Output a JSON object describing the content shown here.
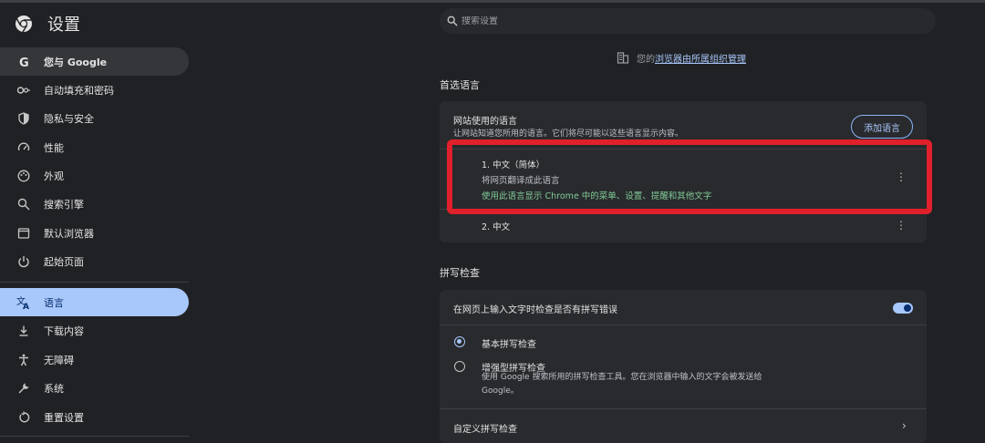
{
  "app": {
    "title": "设置"
  },
  "search": {
    "placeholder": "搜索设置"
  },
  "managed": {
    "prefix": "您的",
    "link": "浏览器由所属组织管理"
  },
  "sidebar": {
    "items": [
      {
        "label": "您与 Google",
        "icon": "google-g-icon"
      },
      {
        "label": "自动填充和密码",
        "icon": "key-icon"
      },
      {
        "label": "隐私与安全",
        "icon": "shield-icon"
      },
      {
        "label": "性能",
        "icon": "speedometer-icon"
      },
      {
        "label": "外观",
        "icon": "palette-icon"
      },
      {
        "label": "搜索引擎",
        "icon": "search-icon"
      },
      {
        "label": "默认浏览器",
        "icon": "browser-window-icon"
      },
      {
        "label": "起始页面",
        "icon": "power-icon"
      },
      {
        "label": "语言",
        "icon": "translate-icon"
      },
      {
        "label": "下载内容",
        "icon": "download-icon"
      },
      {
        "label": "无障碍",
        "icon": "accessibility-icon"
      },
      {
        "label": "系统",
        "icon": "wrench-icon"
      },
      {
        "label": "重置设置",
        "icon": "reset-icon"
      }
    ]
  },
  "preferred_languages": {
    "section_title": "首选语言",
    "card_title": "网站使用的语言",
    "card_desc": "让网站知道您所用的语言。它们将尽可能以这些语言显示内容。",
    "add_button": "添加语言",
    "languages": [
      {
        "name": "1. 中文（简体）",
        "sub": "将网页翻译成此语言",
        "note": "使用此语言显示 Chrome 中的菜单、设置、提醒和其他文字"
      },
      {
        "name": "2. 中文"
      }
    ]
  },
  "spellcheck": {
    "section_title": "拼写检查",
    "toggle_label": "在网页上输入文字时检查是否有拼写错误",
    "toggle_on": true,
    "basic_label": "基本拼写检查",
    "enhanced_label": "增强型拼写检查",
    "enhanced_desc_line1": "使用 Google 搜索所用的拼写检查工具。您在浏览器中输入的文字会被发送给",
    "enhanced_desc_line2": "Google。",
    "custom_label": "自定义拼写检查"
  },
  "colors": {
    "accent": "#a8c7fa",
    "highlight": "#e0202a",
    "green_note": "#81c995"
  }
}
